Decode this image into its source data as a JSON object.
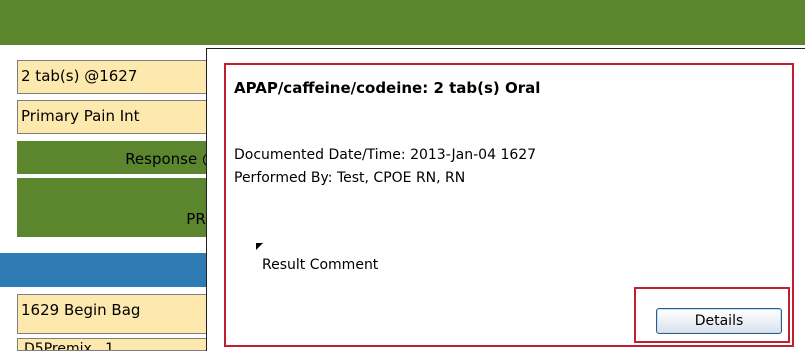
{
  "grid": {
    "rows": [
      {
        "text": "2 tab(s) @1627",
        "kind": "value"
      },
      {
        "text": "Primary Pain Int",
        "kind": "value"
      },
      {
        "text": "Response @",
        "kind": "section"
      },
      {
        "text": "PRN",
        "kind": "section"
      },
      {
        "text": "",
        "kind": "band"
      },
      {
        "text": "1629 Begin Bag",
        "kind": "value"
      },
      {
        "text": "D5Premix...1",
        "kind": "value"
      }
    ]
  },
  "popup": {
    "title": "APAP/caffeine/codeine: 2 tab(s) Oral",
    "documented": "Documented Date/Time: 2013-Jan-04 1627",
    "performed_by": "Performed By: Test, CPOE RN, RN",
    "result_comment": "Result Comment",
    "details_label": "Details"
  },
  "colors": {
    "header_green": "#5b862d",
    "cell_yellow": "#fde8ad",
    "band_blue": "#2e7cb3",
    "highlight_red": "#bf1f2f"
  }
}
